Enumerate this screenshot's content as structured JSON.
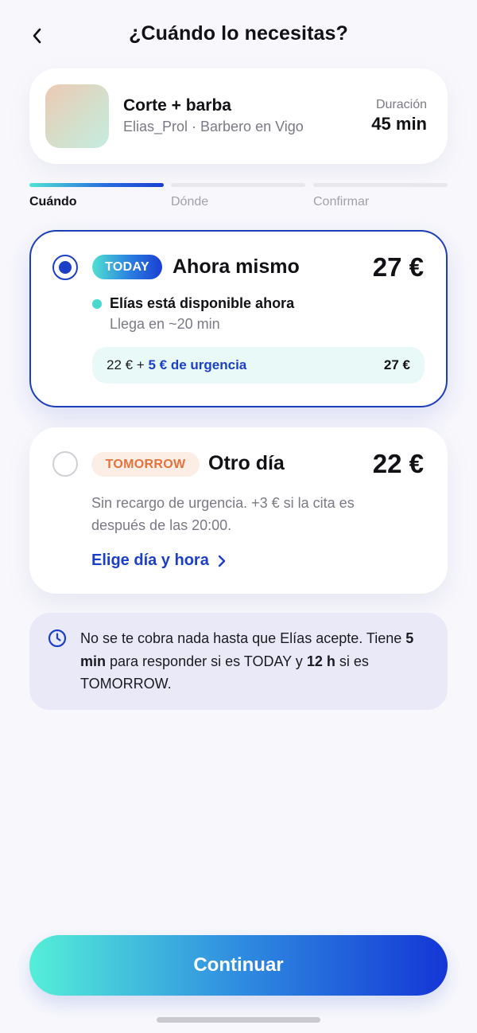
{
  "header": {
    "title": "¿Cuándo lo necesitas?",
    "back_icon": "chevron-left-icon"
  },
  "service": {
    "name": "Corte + barba",
    "provider": "Elias_Prol · Barbero en Vigo",
    "duration_label": "Duración",
    "duration_value": "45 min"
  },
  "steps": [
    {
      "label": "Cuándo",
      "active": true
    },
    {
      "label": "Dónde",
      "active": false
    },
    {
      "label": "Confirmar",
      "active": false
    }
  ],
  "options": {
    "now": {
      "selected": true,
      "badge": "TODAY",
      "title": "Ahora mismo",
      "price": "27 €",
      "availability": "Elías está disponible ahora",
      "eta": "Llega en ~20 min",
      "breakdown_base": "22 € + ",
      "breakdown_urgency": "5 € de urgencia",
      "breakdown_total": "27 €"
    },
    "later": {
      "selected": false,
      "badge": "TOMORROW",
      "title": "Otro día",
      "price": "22 €",
      "description": "Sin recargo de urgencia. +3 € si la cita es después de las 20:00.",
      "link_label": "Elige día y hora"
    }
  },
  "info": {
    "icon": "clock-icon",
    "part1": "No se te cobra nada hasta que Elías acepte. Tiene ",
    "bold1": "5 min",
    "part2": " para responder si es TODAY y ",
    "bold2": "12 h",
    "part3": " si es TOMORROW."
  },
  "cta": {
    "label": "Continuar"
  },
  "colors": {
    "accent": "#1c3fc8",
    "teal": "#4fe3d3",
    "tomorrow_text": "#e2733c",
    "tomorrow_bg": "#fdeee5"
  }
}
